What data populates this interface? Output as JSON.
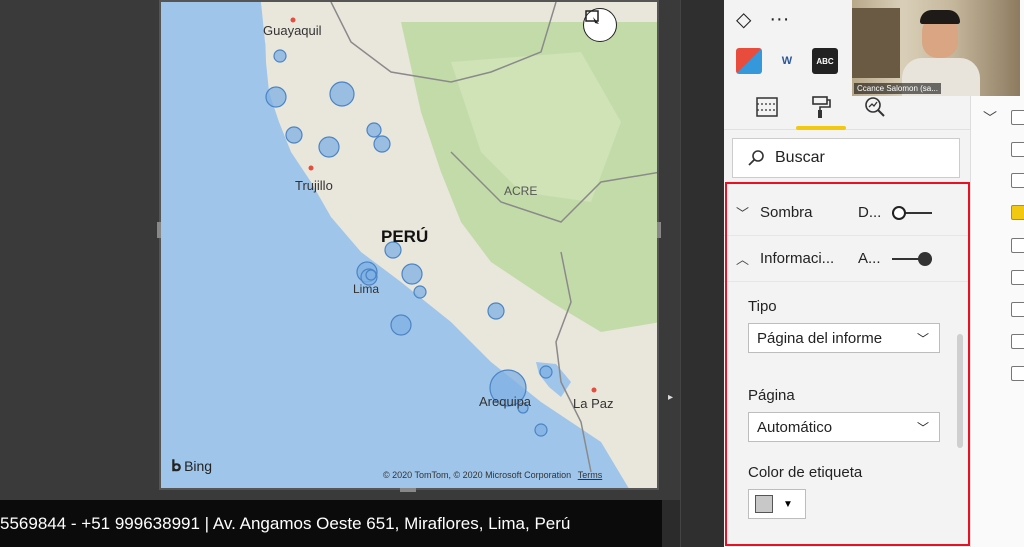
{
  "map": {
    "country_label": "PERÚ",
    "cities": [
      "Guayaquil",
      "Trujillo",
      "Lima",
      "Arequipa",
      "La Paz"
    ],
    "region_label": "ACRE",
    "attribution": "© 2020 TomTom, © 2020 Microsoft Corporation",
    "terms_label": "Terms",
    "brand": "Bing",
    "bubble_color": "#7fb0e4",
    "bubble_edge_color": "#4b84c4"
  },
  "footer": {
    "text": "5569844 - +51 999638991 | Av. Angamos Oeste 651, Miraflores, Lima, Perú"
  },
  "pane": {
    "more_label": "···",
    "apps": [
      "W",
      "ABC"
    ],
    "search_label": "Buscar",
    "sections": [
      {
        "label": "Sombra",
        "value": "D...",
        "state": "off"
      },
      {
        "label": "Informaci...",
        "value": "A...",
        "state": "on"
      }
    ],
    "tipo_label": "Tipo",
    "tipo_value": "Página del informe",
    "pagina_label": "Página",
    "pagina_value": "Automático",
    "color_label": "Color de etiqueta",
    "color_swatch": "#c8c8c8",
    "highlight_color": "#e81123",
    "accent_color": "#f2c811"
  },
  "video": {
    "name": "Ccance Salomon (sa..."
  }
}
